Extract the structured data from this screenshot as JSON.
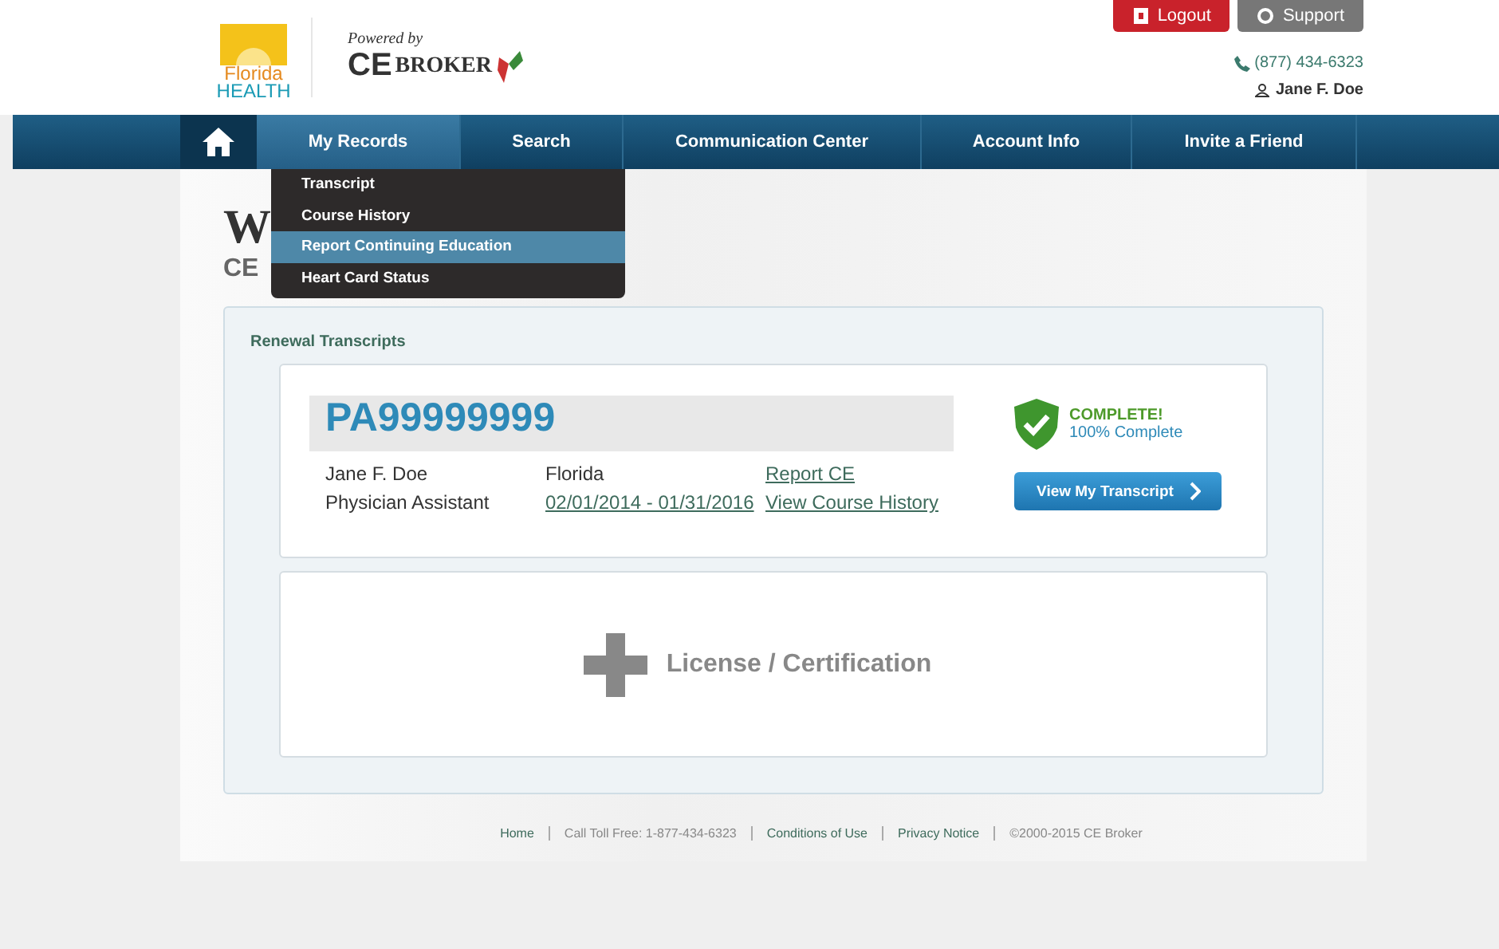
{
  "header": {
    "logo_top": "Florida",
    "logo_bottom": "HEALTH",
    "powered_by": "Powered by",
    "broker_logo_ce": "CE",
    "broker_logo_name": "BROKER",
    "buttons": [
      {
        "label": "Logout",
        "kind": "logout"
      },
      {
        "label": "Support",
        "kind": "support"
      }
    ],
    "phone": "(877) 434-6323",
    "user": "Jane F. Doe"
  },
  "nav": {
    "items": [
      {
        "label": "My Records",
        "selected": true
      },
      {
        "label": "Search",
        "selected": false
      },
      {
        "label": "Communication Center",
        "selected": false
      },
      {
        "label": "Account Info",
        "selected": false
      },
      {
        "label": "Invite a Friend",
        "selected": false
      }
    ],
    "menu": [
      {
        "label": "Transcript",
        "selected": false
      },
      {
        "label": "Course History",
        "selected": false
      },
      {
        "label": "Report Continuing Education",
        "selected": true
      },
      {
        "label": "Heart Card Status",
        "selected": false
      }
    ]
  },
  "heading": "W",
  "subheading": "CE",
  "renewal": {
    "title": "Renewal Transcripts",
    "license": "PA99999999",
    "name": "Jane F. Doe",
    "state": "Florida",
    "profession": "Physician Assistant",
    "period": "02/01/2014 - 01/31/2016",
    "links": [
      "Report CE",
      "View Course History"
    ],
    "status": "COMPLETE!",
    "percent": "100% Complete",
    "button": "View My Transcript"
  },
  "add_card": {
    "label": "License / Certification"
  },
  "footer": [
    {
      "text": "Home",
      "kind": "link"
    },
    {
      "text": "Call Toll Free: 1-877-434-6323",
      "kind": "text"
    },
    {
      "text": "Conditions of Use",
      "kind": "link"
    },
    {
      "text": "Privacy Notice",
      "kind": "link"
    },
    {
      "text": "©2000-2015 CE Broker",
      "kind": "text"
    }
  ]
}
